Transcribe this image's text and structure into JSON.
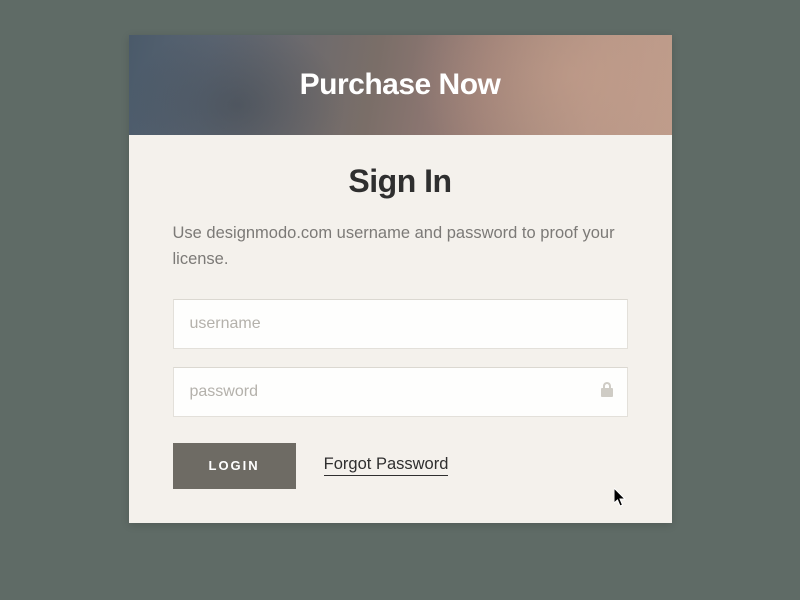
{
  "header": {
    "title": "Purchase Now"
  },
  "signin": {
    "title": "Sign In",
    "instruction": "Use designmodo.com username and password to proof your license.",
    "username_placeholder": "username",
    "password_placeholder": "password",
    "login_label": "LOGIN",
    "forgot_label": "Forgot Password"
  }
}
